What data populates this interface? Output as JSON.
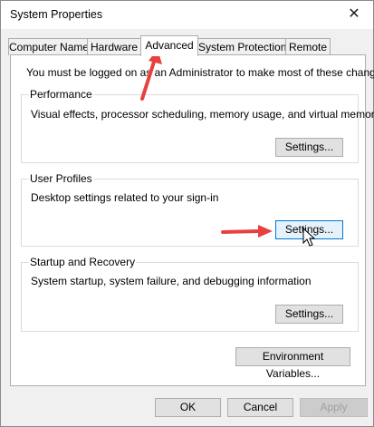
{
  "window": {
    "title": "System Properties",
    "close_glyph": "✕"
  },
  "tabs": [
    {
      "label": "Computer Name"
    },
    {
      "label": "Hardware"
    },
    {
      "label": "Advanced",
      "active": true
    },
    {
      "label": "System Protection"
    },
    {
      "label": "Remote"
    }
  ],
  "advanced": {
    "intro": "You must be logged on as an Administrator to make most of these changes.",
    "performance": {
      "title": "Performance",
      "description": "Visual effects, processor scheduling, memory usage, and virtual memory",
      "button": "Settings..."
    },
    "user_profiles": {
      "title": "User Profiles",
      "description": "Desktop settings related to your sign-in",
      "button": "Settings..."
    },
    "startup_recovery": {
      "title": "Startup and Recovery",
      "description": "System startup, system failure, and debugging information",
      "button": "Settings..."
    },
    "env_button": "Environment Variables..."
  },
  "footer": {
    "ok": "OK",
    "cancel": "Cancel",
    "apply": "Apply"
  },
  "colors": {
    "annotation_arrow": "#e8403f",
    "focus_border": "#0078d7"
  }
}
